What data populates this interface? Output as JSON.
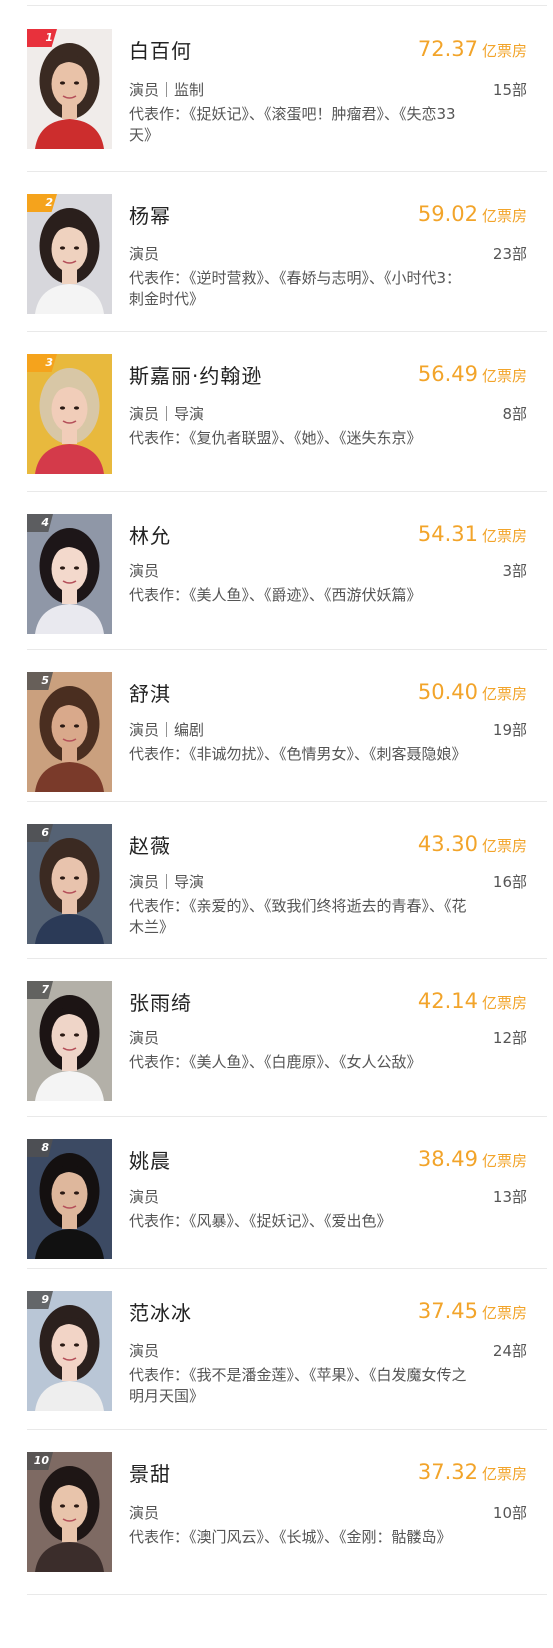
{
  "unit_label": "亿票房",
  "works_prefix": "代表作：",
  "ranking": [
    {
      "rank": "1",
      "name": "白百何",
      "box_office": "72.37",
      "roles": "演员｜监制",
      "film_count": "15部",
      "works": "《捉妖记》、《滚蛋吧！肿瘤君》、《失恋33天》",
      "badge_color": "#e8313c",
      "has_crown": true
    },
    {
      "rank": "2",
      "name": "杨幂",
      "box_office": "59.02",
      "roles": "演员",
      "film_count": "23部",
      "works": "《逆时营救》、《春娇与志明》、《小时代3：刺金时代》",
      "badge_color": "#f5a31c",
      "has_crown": true
    },
    {
      "rank": "3",
      "name": "斯嘉丽·约翰逊",
      "box_office": "56.49",
      "roles": "演员｜导演",
      "film_count": "8部",
      "works": "《复仇者联盟》、《她》、《迷失东京》",
      "badge_color": "#f5a31c",
      "has_crown": true
    },
    {
      "rank": "4",
      "name": "林允",
      "box_office": "54.31",
      "roles": "演员",
      "film_count": "3部",
      "works": "《美人鱼》、《爵迹》、《西游伏妖篇》",
      "badge_color": "#555555",
      "has_crown": false
    },
    {
      "rank": "5",
      "name": "舒淇",
      "box_office": "50.40",
      "roles": "演员｜编剧",
      "film_count": "19部",
      "works": "《非诚勿扰》、《色情男女》、《刺客聂隐娘》",
      "badge_color": "#555555",
      "has_crown": false
    },
    {
      "rank": "6",
      "name": "赵薇",
      "box_office": "43.30",
      "roles": "演员｜导演",
      "film_count": "16部",
      "works": "《亲爱的》、《致我们终将逝去的青春》、《花木兰》",
      "badge_color": "#555555",
      "has_crown": false
    },
    {
      "rank": "7",
      "name": "张雨绮",
      "box_office": "42.14",
      "roles": "演员",
      "film_count": "12部",
      "works": "《美人鱼》、《白鹿原》、《女人公敌》",
      "badge_color": "#555555",
      "has_crown": false
    },
    {
      "rank": "8",
      "name": "姚晨",
      "box_office": "38.49",
      "roles": "演员",
      "film_count": "13部",
      "works": "《风暴》、《捉妖记》、《爱出色》",
      "badge_color": "#555555",
      "has_crown": false
    },
    {
      "rank": "9",
      "name": "范冰冰",
      "box_office": "37.45",
      "roles": "演员",
      "film_count": "24部",
      "works": "《我不是潘金莲》、《苹果》、《白发魔女传之明月天国》",
      "badge_color": "#555555",
      "has_crown": false
    },
    {
      "rank": "10",
      "name": "景甜",
      "box_office": "37.32",
      "roles": "演员",
      "film_count": "10部",
      "works": "《澳门风云》、《长城》、《金刚：骷髅岛》",
      "badge_color": "#555555",
      "has_crown": false
    }
  ]
}
